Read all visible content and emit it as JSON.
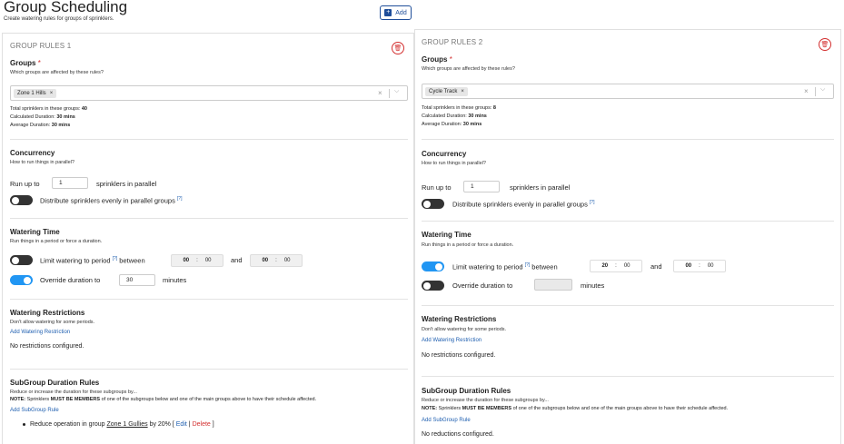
{
  "page": {
    "title": "Group Scheduling",
    "subtitle": "Create watering rules for groups of sprinklers.",
    "add_label": "Add"
  },
  "colors": {
    "accent": "#2196f3",
    "link": "#1f5fb0",
    "danger": "#d32f2f",
    "toggle_off": "#333333"
  },
  "group1": {
    "header": "GROUP RULES 1",
    "groups_title": "Groups",
    "groups_required": "*",
    "groups_sub": "Which groups are affected by these rules?",
    "chip": "Zone 1 Hills",
    "chip_remove": "×",
    "clear": "×",
    "chevron": "⌵",
    "stat_total_label": "Total sprinklers in these groups:",
    "stat_total_value": "40",
    "stat_calc_label": "Calculated Duration:",
    "stat_calc_value": "30 mins",
    "stat_avg_label": "Average Duration:",
    "stat_avg_value": "30 mins",
    "concurrency_title": "Concurrency",
    "concurrency_sub": "How to run things in parallel?",
    "run_up_to": "Run up to",
    "parallel_value": "1",
    "sprinklers_in_parallel": "sprinklers in parallel",
    "distribute_label": "Distribute sprinklers evenly in parallel groups",
    "help": "[?]",
    "distribute_on": false,
    "watering_title": "Watering Time",
    "watering_sub": "Run things in a period or force a duration.",
    "limit_label": "Limit watering to period",
    "limit_on": false,
    "between": "between",
    "start_hh": "00",
    "start_mm": "00",
    "and": "and",
    "end_hh": "00",
    "end_mm": "00",
    "colon": ":",
    "override_label": "Override duration to",
    "override_on": true,
    "override_value": "30",
    "minutes": "minutes",
    "restrictions_title": "Watering Restrictions",
    "restrictions_sub": "Don't allow watering for some periods.",
    "add_restriction": "Add Watering Restriction",
    "no_restrictions": "No restrictions configured.",
    "subgroup_title": "SubGroup Duration Rules",
    "subgroup_sub": "Reduce or increase the duration for these subgroups by...",
    "note_prefix": "NOTE:",
    "note_text_1": "Sprinklers",
    "note_bold": "MUST BE MEMBERS",
    "note_text_2": "of one of the subgroups below and one of the main groups above to have their schedule affected.",
    "add_subgroup": "Add SubGroup Rule",
    "rule_prefix": "Reduce operation in group",
    "rule_group": "Zone 1 Gullies",
    "rule_suffix": "by 20% [",
    "rule_edit": "Edit",
    "rule_sep": "|",
    "rule_delete": "Delete",
    "rule_end": "]"
  },
  "group2": {
    "header": "GROUP RULES 2",
    "groups_title": "Groups",
    "groups_required": "*",
    "groups_sub": "Which groups are affected by these rules?",
    "chip": "Cycle Track",
    "chip_remove": "×",
    "clear": "×",
    "chevron": "⌵",
    "stat_total_label": "Total sprinklers in these groups:",
    "stat_total_value": "8",
    "stat_calc_label": "Calculated Duration:",
    "stat_calc_value": "30 mins",
    "stat_avg_label": "Average Duration:",
    "stat_avg_value": "30 mins",
    "concurrency_title": "Concurrency",
    "concurrency_sub": "How to run things in parallel?",
    "run_up_to": "Run up to",
    "parallel_value": "1",
    "sprinklers_in_parallel": "sprinklers in parallel",
    "distribute_label": "Distribute sprinklers evenly in parallel groups",
    "help": "[?]",
    "distribute_on": false,
    "watering_title": "Watering Time",
    "watering_sub": "Run things in a period or force a duration.",
    "limit_label": "Limit watering to period",
    "limit_on": true,
    "between": "between",
    "start_hh": "20",
    "start_mm": "00",
    "and": "and",
    "end_hh": "00",
    "end_mm": "00",
    "colon": ":",
    "override_label": "Override duration to",
    "override_on": false,
    "override_value": "",
    "minutes": "minutes",
    "restrictions_title": "Watering Restrictions",
    "restrictions_sub": "Don't allow watering for some periods.",
    "add_restriction": "Add Watering Restriction",
    "no_restrictions": "No restrictions configured.",
    "subgroup_title": "SubGroup Duration Rules",
    "subgroup_sub": "Reduce or increase the duration for these subgroups by...",
    "note_prefix": "NOTE:",
    "note_text_1": "Sprinklers",
    "note_bold": "MUST BE MEMBERS",
    "note_text_2": "of one of the subgroups below and one of the main groups above to have their schedule affected.",
    "add_subgroup": "Add SubGroup Rule",
    "no_reductions": "No reductions configured."
  }
}
